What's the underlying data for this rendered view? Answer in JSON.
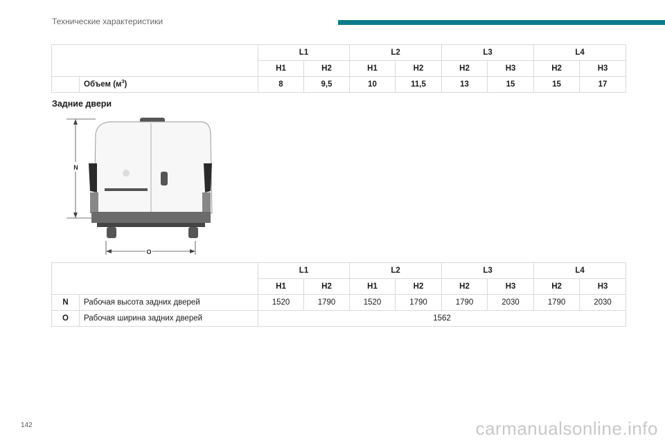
{
  "header": {
    "title": "Технические характеристики"
  },
  "volume_table": {
    "groups": [
      "L1",
      "L2",
      "L3",
      "L4"
    ],
    "heights": [
      "H1",
      "H2",
      "H1",
      "H2",
      "H2",
      "H3",
      "H2",
      "H3"
    ],
    "row": {
      "label": "Объем (м",
      "unit_sup": "3",
      "label_suffix": ")",
      "values": [
        "8",
        "9,5",
        "10",
        "11,5",
        "13",
        "15",
        "15",
        "17"
      ]
    }
  },
  "section_title": "Задние двери",
  "figure": {
    "label_n": "N",
    "label_o": "O"
  },
  "doors_table": {
    "groups": [
      "L1",
      "L2",
      "L3",
      "L4"
    ],
    "heights": [
      "H1",
      "H2",
      "H1",
      "H2",
      "H2",
      "H3",
      "H2",
      "H3"
    ],
    "rows": [
      {
        "code": "N",
        "label": "Рабочая высота задних дверей",
        "values": [
          "1520",
          "1790",
          "1520",
          "1790",
          "1790",
          "2030",
          "1790",
          "2030"
        ]
      },
      {
        "code": "O",
        "label": "Рабочая ширина задних дверей",
        "value": "1562"
      }
    ]
  },
  "footer": {
    "page_number": "142",
    "watermark": "carmanualsonline.info"
  }
}
